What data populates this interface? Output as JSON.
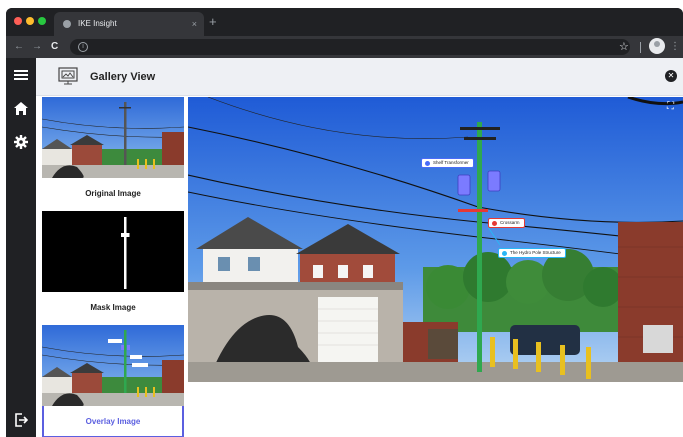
{
  "browser": {
    "tab_title": "IKE Insight",
    "tab_close": "×",
    "new_tab": "+",
    "back": "←",
    "forward": "→",
    "reload": "C",
    "info": "i",
    "star": "☆",
    "menu": "⋮"
  },
  "sidebar": {
    "icons": [
      "menu-icon",
      "home-icon",
      "gear-icon",
      "logout-icon"
    ]
  },
  "header": {
    "title": "Gallery View",
    "close": "✕"
  },
  "thumbnails": [
    {
      "label": "Original Image",
      "selected": false
    },
    {
      "label": "Mask Image",
      "selected": false
    },
    {
      "label": "Overlay Image",
      "selected": true
    }
  ],
  "viewer": {
    "fullscreen": "⛶",
    "annotations": [
      {
        "label": "Shelf Transformer",
        "color": "#4a6cf7"
      },
      {
        "label": "Crossarm",
        "color": "#e53935"
      },
      {
        "label": "The Hydro Pole Structure",
        "color": "#29b6f6"
      }
    ]
  },
  "colors": {
    "accent": "#5b5fe0",
    "sidebar": "#202124",
    "pole": "#2fa84f",
    "transformer": "#7b7bff"
  }
}
